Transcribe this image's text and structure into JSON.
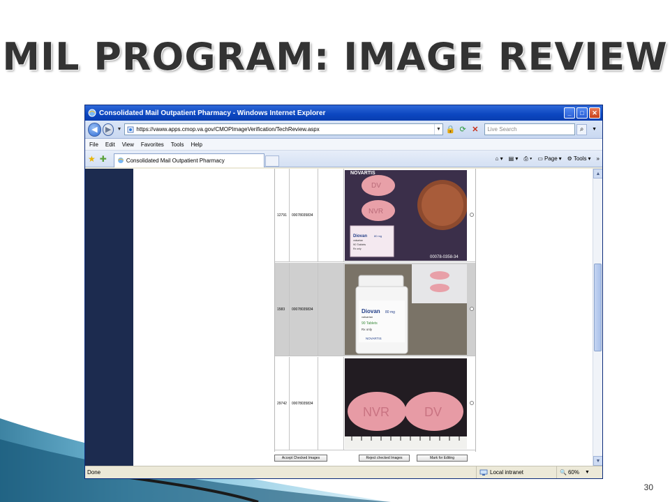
{
  "slide": {
    "title": "MIL PROGRAM: IMAGE REVIEW",
    "page_number": "30"
  },
  "browser": {
    "window_title": "Consolidated Mail Outpatient Pharmacy - Windows Internet Explorer",
    "url": "https://vaww.apps.cmop.va.gov/CMOPImageVerification/TechReview.aspx",
    "search_placeholder": "Live Search",
    "menu": [
      "File",
      "Edit",
      "View",
      "Favorites",
      "Tools",
      "Help"
    ],
    "tab_label": "Consolidated Mail Outpatient Pharmacy",
    "commands": {
      "page": "Page",
      "tools": "Tools"
    },
    "status_text": "Done",
    "zone": "Local intranet",
    "zoom": "60%"
  },
  "rows": [
    {
      "id": "12791",
      "ndc": "00078035834",
      "image": {
        "brand": "NOVARTIS",
        "pill_marks": [
          "DV",
          "NVR"
        ],
        "label_name": "Diovan",
        "label_generic": "valsartan",
        "label_strength": "80 mg",
        "label_count": "90 Tablets",
        "label_rx": "Rx only",
        "caption": "00078-0358-34"
      }
    },
    {
      "id": "1583",
      "ndc": "00078035834",
      "image": {
        "brand": "NOVARTIS",
        "label_name": "Diovan",
        "label_generic": "valsartan",
        "label_strength": "80 mg",
        "label_count": "90 Tablets",
        "label_rx": "Rx only"
      }
    },
    {
      "id": "29742",
      "ndc": "00078035834",
      "image": {
        "pill_marks": [
          "NVR",
          "DV"
        ]
      }
    }
  ],
  "actions": {
    "accept": "Accept Checked Images",
    "reject": "Reject checked Images",
    "mark": "Mark for Editing"
  },
  "colors": {
    "title_text": "#333333",
    "ie_blue": "#0b46c0",
    "nav_panel": "#1c2b4f",
    "pill_pink": "#e8a0a8"
  }
}
